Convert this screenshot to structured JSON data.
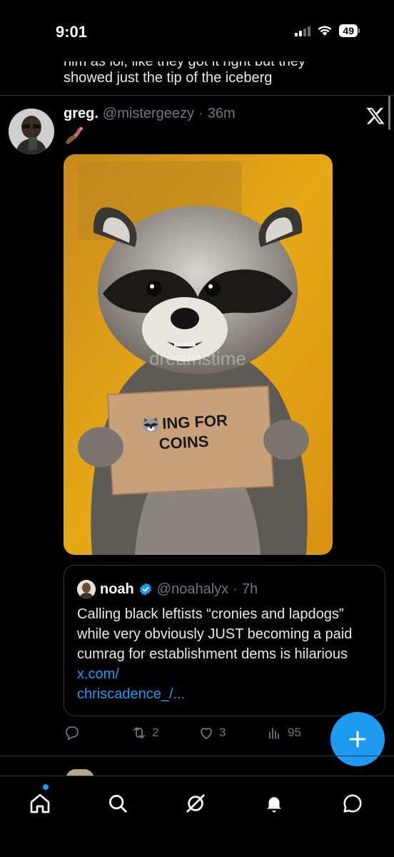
{
  "status_bar": {
    "time": "9:01",
    "battery": "49"
  },
  "previous_tweet": {
    "clipped_line": "him as lol, like they got it right but they",
    "last_line": "showed just the tip of the iceberg"
  },
  "tweet": {
    "display_name": "greg.",
    "handle": "@mistergeezy",
    "separator": "·",
    "time": "36m",
    "body_emoji": "nail-polish-emoji",
    "media": {
      "sign_line1": "ING FOR",
      "sign_line2": "COINS",
      "sign_emoji": "raccoon-emoji",
      "watermark": "dreamstime"
    },
    "quote": {
      "display_name": "noah",
      "verified": true,
      "handle": "@noahalyx",
      "separator": "·",
      "time": "7h",
      "text": "Calling black leftists “cronies and lapdogs” while very obviously JUST becoming a paid cumrag for establishment dems is hilarious ",
      "link_part1": "x.com/",
      "link_part2": "chriscadence_/..."
    },
    "actions": {
      "replies": "",
      "reposts": "2",
      "likes": "3",
      "views": "95"
    }
  },
  "tabbar": {
    "items": [
      "home",
      "search",
      "grok",
      "notifications",
      "messages"
    ]
  },
  "colors": {
    "accent": "#1d9bf0",
    "background": "#000000",
    "secondary_text": "#71767b"
  }
}
